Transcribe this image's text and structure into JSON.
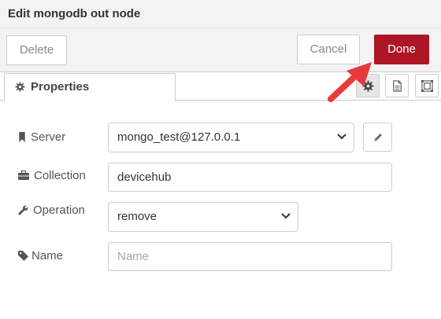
{
  "dialog": {
    "title": "Edit mongodb out node"
  },
  "toolbar": {
    "delete_label": "Delete",
    "cancel_label": "Cancel",
    "done_label": "Done"
  },
  "tabs": {
    "properties_label": "Properties",
    "icons": [
      "gear-icon",
      "description-icon",
      "appearance-icon"
    ]
  },
  "form": {
    "server": {
      "label": "Server",
      "value": "mongo_test@127.0.0.1"
    },
    "collection": {
      "label": "Collection",
      "value": "devicehub"
    },
    "operation": {
      "label": "Operation",
      "value": "remove"
    },
    "name": {
      "label": "Name",
      "value": "",
      "placeholder": "Name"
    }
  },
  "colors": {
    "done_button": "#ad1625",
    "annotation_arrow": "#e8393d"
  }
}
